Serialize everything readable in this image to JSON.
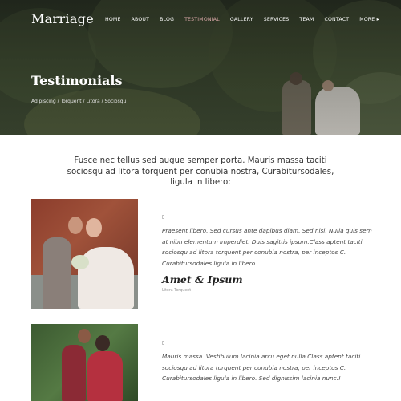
{
  "header": {
    "logo": "Marriage",
    "nav": [
      {
        "label": "HOME",
        "active": false
      },
      {
        "label": "ABOUT",
        "active": false
      },
      {
        "label": "BLOG",
        "active": false
      },
      {
        "label": "TESTIMONIAL",
        "active": true
      },
      {
        "label": "GALLERY",
        "active": false
      },
      {
        "label": "SERVICES",
        "active": false
      },
      {
        "label": "TEAM",
        "active": false
      },
      {
        "label": "CONTACT",
        "active": false
      },
      {
        "label": "MORE ▸",
        "active": false
      }
    ]
  },
  "hero": {
    "title": "Testimonials",
    "breadcrumb": "Adipiscing / Torquent / Litora / Sociosqu"
  },
  "intro": "Fusce nec tellus sed augue semper porta. Mauris massa taciti sociosqu ad litora torquent per conubia nostra, Curabitursodales, ligula in libero:",
  "testimonials": [
    {
      "quote_icon": "▯",
      "text": "Praesent libero. Sed cursus ante dapibus diam. Sed nisi. Nulla quis sem at nibh elementum imperdiet. Duis sagittis ipsum.Class aptent taciti sociosqu ad litora torquent per conubia nostra, per inceptos C. Curabitursodales ligula in libero.",
      "name": "Amet & Ipsum",
      "role": "Litora Torquent"
    },
    {
      "quote_icon": "▯",
      "text": "Mauris massa. Vestibulum lacinia arcu eget nulla.Class aptent taciti sociosqu ad litora torquent per conubia nostra, per inceptos C. Curabitursodales ligula in libero. Sed dignissim lacinia nunc.!"
    }
  ],
  "colors": {
    "nav_active": "#d9a7a7",
    "hero_overlay": "#2f3a28"
  }
}
